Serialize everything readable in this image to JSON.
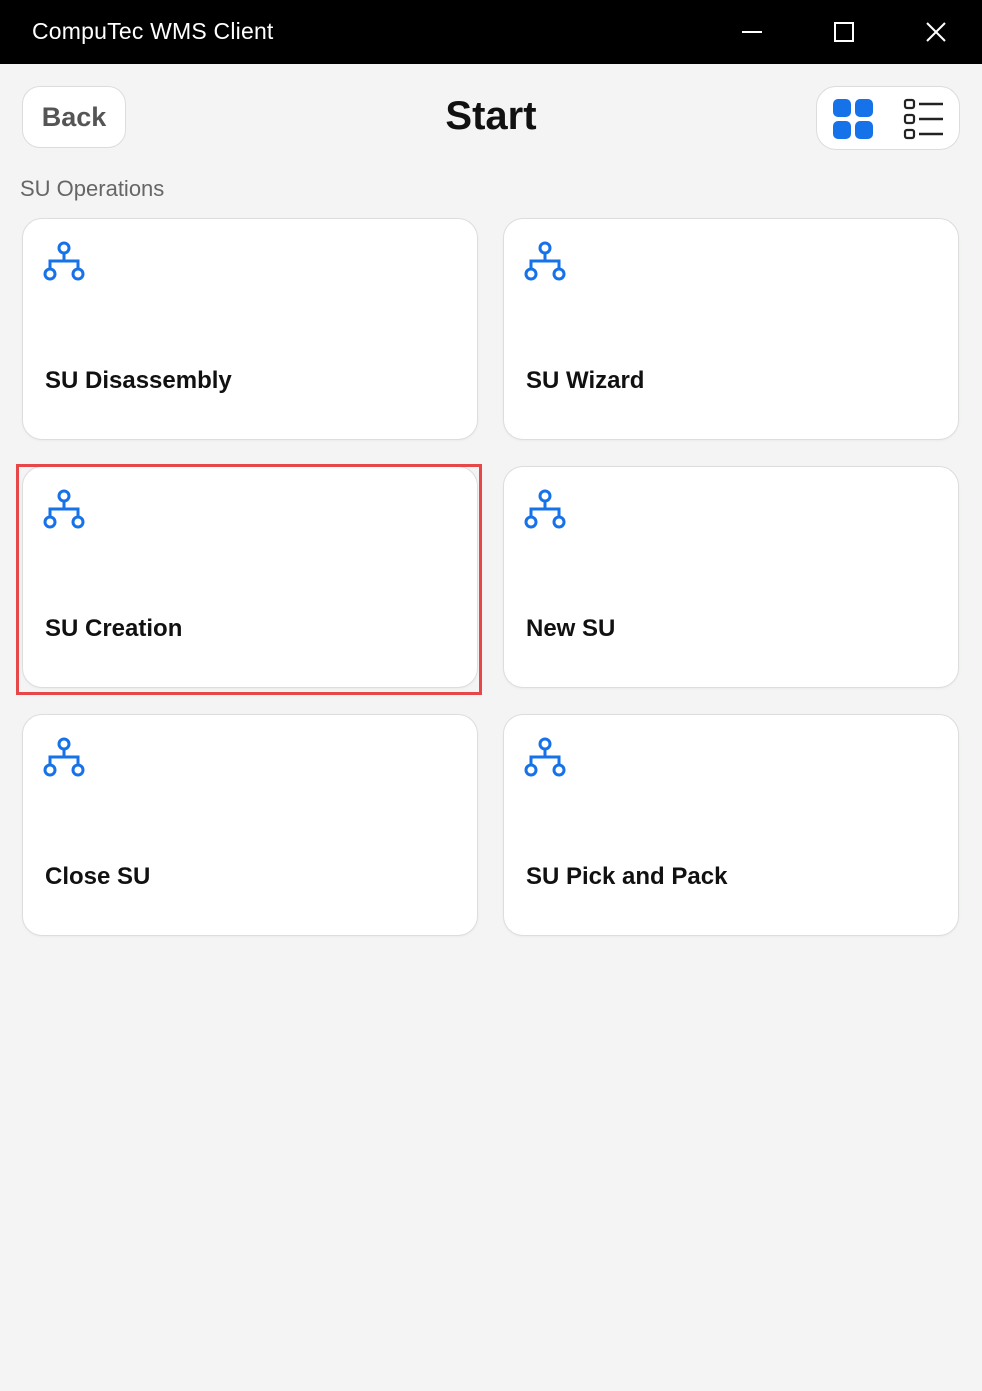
{
  "window": {
    "title": "CompuTec WMS Client",
    "controls": [
      "minimize-icon",
      "maximize-icon",
      "close-icon"
    ]
  },
  "header": {
    "back_label": "Back",
    "title": "Start",
    "view_toggle": {
      "active": "grid",
      "options": [
        "grid-view-icon",
        "list-view-icon"
      ]
    }
  },
  "section": {
    "label": "SU Operations",
    "tiles": [
      {
        "label": "SU Disassembly",
        "icon": "hierarchy-icon"
      },
      {
        "label": "SU Wizard",
        "icon": "hierarchy-icon"
      },
      {
        "label": "SU Creation",
        "icon": "hierarchy-icon",
        "highlighted": true
      },
      {
        "label": "New SU",
        "icon": "hierarchy-icon"
      },
      {
        "label": "Close SU",
        "icon": "hierarchy-icon"
      },
      {
        "label": "SU Pick and Pack",
        "icon": "hierarchy-icon"
      }
    ]
  },
  "colors": {
    "accent": "#1672e8",
    "highlight": "#e8474a",
    "titlebar": "#000000",
    "background": "#f3f4f3"
  }
}
